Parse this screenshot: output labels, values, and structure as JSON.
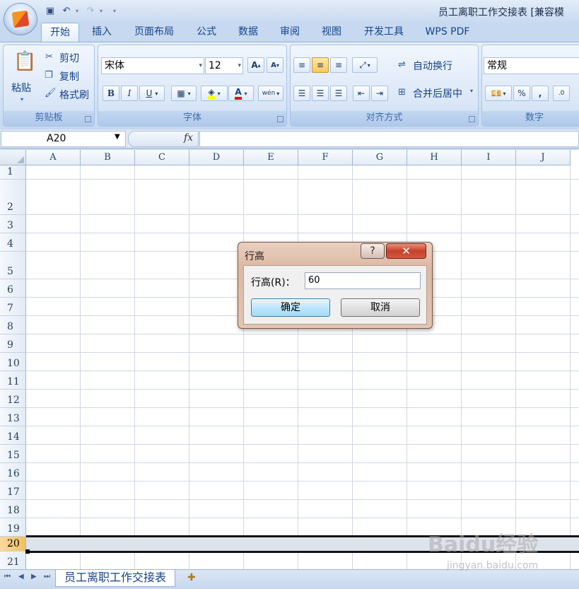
{
  "window": {
    "title": "员工离职工作交接表  [兼容模"
  },
  "quick_access": {
    "items": [
      {
        "icon": "save-icon",
        "glyph": "▣"
      },
      {
        "icon": "undo-icon",
        "glyph": "↶"
      },
      {
        "icon": "redo-icon",
        "glyph": "↷"
      }
    ]
  },
  "tabs": [
    "开始",
    "插入",
    "页面布局",
    "公式",
    "数据",
    "审阅",
    "视图",
    "开发工具",
    "WPS PDF"
  ],
  "ribbon": {
    "clipboard": {
      "label": "剪贴板",
      "paste": "粘贴",
      "cut": "剪切",
      "copy": "复制",
      "format_painter": "格式刷"
    },
    "font": {
      "label": "字体",
      "font_name": "宋体",
      "font_size": "12",
      "bold": "B",
      "italic": "I",
      "underline": "U",
      "grow": "A",
      "shrink": "A",
      "font_color_letter": "A",
      "phonetic": "wén",
      "fill_color": "#ffff00",
      "font_color": "#ff0000"
    },
    "alignment": {
      "label": "对齐方式",
      "wrap_text": "自动换行",
      "merge_center": "合并后居中"
    },
    "number": {
      "label": "数字",
      "format": "常规",
      "percent": "%",
      "comma": ","
    }
  },
  "formula_bar": {
    "name_box": "A20",
    "fx": "fx",
    "formula": ""
  },
  "grid": {
    "columns": [
      "A",
      "B",
      "C",
      "D",
      "E",
      "F",
      "G",
      "H",
      "I",
      "J"
    ],
    "rows": [
      "1",
      "2",
      "3",
      "4",
      "5",
      "6",
      "7",
      "8",
      "9",
      "10",
      "11",
      "12",
      "13",
      "14",
      "15",
      "16",
      "17",
      "18",
      "19",
      "20",
      "21"
    ],
    "selected_row": "20"
  },
  "dialog": {
    "title": "行高",
    "help": "?",
    "close": "✕",
    "field_label": "行高(R)：",
    "field_value": "60",
    "ok": "确定",
    "cancel": "取消"
  },
  "sheets": {
    "active": "员工离职工作交接表"
  },
  "watermark": {
    "text": "Baidu经验",
    "sub": "jingyan.baidu.com"
  }
}
